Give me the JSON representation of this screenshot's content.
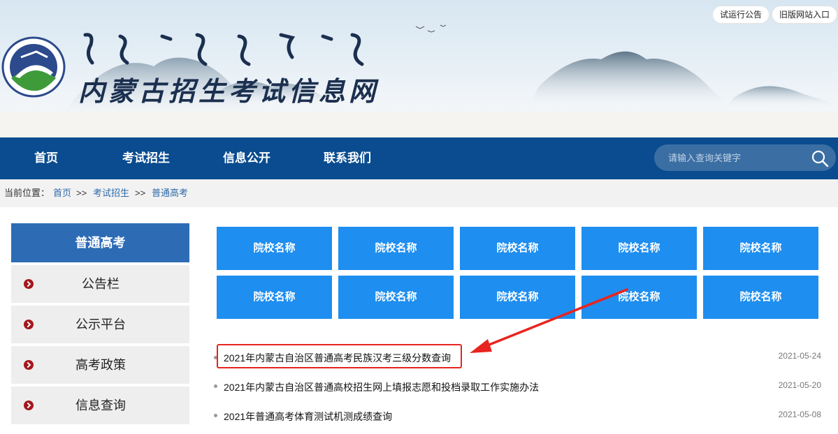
{
  "header": {
    "site_title": "内蒙古招生考试信息网",
    "top_buttons": [
      "试运行公告",
      "旧版网站入口"
    ]
  },
  "nav": {
    "items": [
      "首页",
      "考试招生",
      "信息公开",
      "联系我们"
    ],
    "search_placeholder": "请输入查询关键字"
  },
  "breadcrumb": {
    "prefix": "当前位置：",
    "items": [
      "首页",
      "考试招生",
      "普通高考"
    ],
    "separator": ">>"
  },
  "sidebar": {
    "title": "普通高考",
    "items": [
      "公告栏",
      "公示平台",
      "高考政策",
      "信息查询"
    ]
  },
  "schools": {
    "tiles": [
      "院校名称",
      "院校名称",
      "院校名称",
      "院校名称",
      "院校名称",
      "院校名称",
      "院校名称",
      "院校名称",
      "院校名称",
      "院校名称"
    ]
  },
  "news": [
    {
      "title": "2021年内蒙古自治区普通高考民族汉考三级分数查询",
      "date": "2021-05-24"
    },
    {
      "title": "2021年内蒙古自治区普通高校招生网上填报志愿和投档录取工作实施办法",
      "date": "2021-05-20"
    },
    {
      "title": "2021年普通高考体育测试机测成绩查询",
      "date": "2021-05-08"
    }
  ],
  "colors": {
    "nav_bg": "#0a4c8f",
    "sidebar_head": "#2d6cb5",
    "tile_bg": "#1e8ef0",
    "annotation": "#e8241f"
  }
}
